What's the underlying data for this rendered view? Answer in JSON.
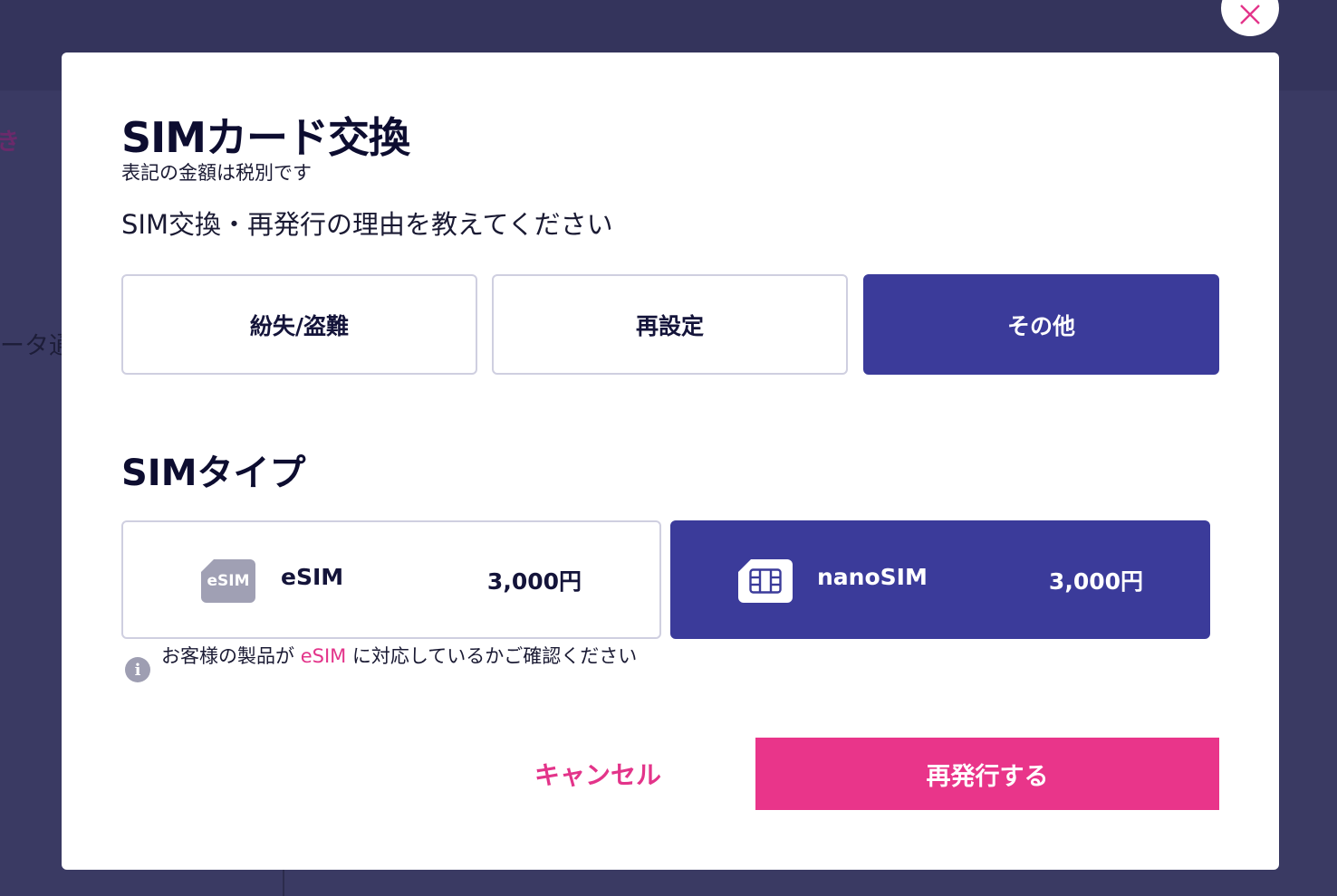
{
  "background": {
    "partial_text_top": "き",
    "partial_text_mid": "ータ通"
  },
  "modal": {
    "title": "SIMカード交換",
    "tax_note": "表記の金額は税別です",
    "question": "SIM交換・再発行の理由を教えてください",
    "reasons": [
      {
        "label": "紛失/盗難",
        "selected": false
      },
      {
        "label": "再設定",
        "selected": false
      },
      {
        "label": "その他",
        "selected": true
      }
    ],
    "sim_type_title": "SIMタイプ",
    "sim_options": [
      {
        "icon": "esim-icon",
        "icon_text": "eSIM",
        "name": "eSIM",
        "price": "3,000円",
        "selected": false
      },
      {
        "icon": "nanosim-icon",
        "name": "nanoSIM",
        "price": "3,000円",
        "selected": true
      }
    ],
    "info": {
      "icon": "i",
      "text_before": "お客様の製品が ",
      "link": "eSIM",
      "text_after": " に対応しているかご確認ください"
    },
    "cancel_label": "キャンセル",
    "submit_label": "再発行する"
  },
  "colors": {
    "accent": "#e9358a",
    "selected": "#3b3b9a",
    "overlay": "#3a3a63"
  }
}
